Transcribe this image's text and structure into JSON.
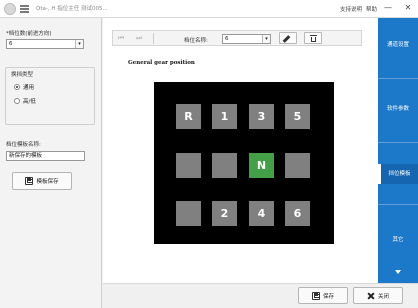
{
  "titlebar": {
    "title": "Ota-, H 指位主任 测试005...",
    "help_label": "支持说明",
    "assist_label": "帮助",
    "minimize": "—",
    "close": "✕"
  },
  "left": {
    "gear_count_label": "*档位数(前进方向)",
    "gear_count_value": "6",
    "shift_type_label": "换挡类型",
    "radio_general": "通用",
    "radio_high_low": "高/低",
    "template_name_label": "档位模板名称:",
    "template_name_value": "新保存的模板",
    "save_template_label": "模板保存"
  },
  "toolbar": {
    "first": "⏮",
    "next": "⏭",
    "name_label": "档位名称:",
    "name_value": "6"
  },
  "main": {
    "heading": "General gear position"
  },
  "gears": {
    "r1": [
      "R",
      "1",
      "3",
      "5"
    ],
    "r2": [
      "",
      "",
      "N",
      ""
    ],
    "r3": [
      "",
      "2",
      "4",
      "6"
    ]
  },
  "right_nav": {
    "items": [
      "通道设置",
      "软件参数",
      "挡位模板",
      "其它"
    ],
    "selected": "挡位模板"
  },
  "bottom": {
    "save": "保存",
    "close": "关闭"
  },
  "colors": {
    "nav_blue": "#1c78c8",
    "active_gear": "#43a047",
    "gear_gray": "#808080"
  }
}
